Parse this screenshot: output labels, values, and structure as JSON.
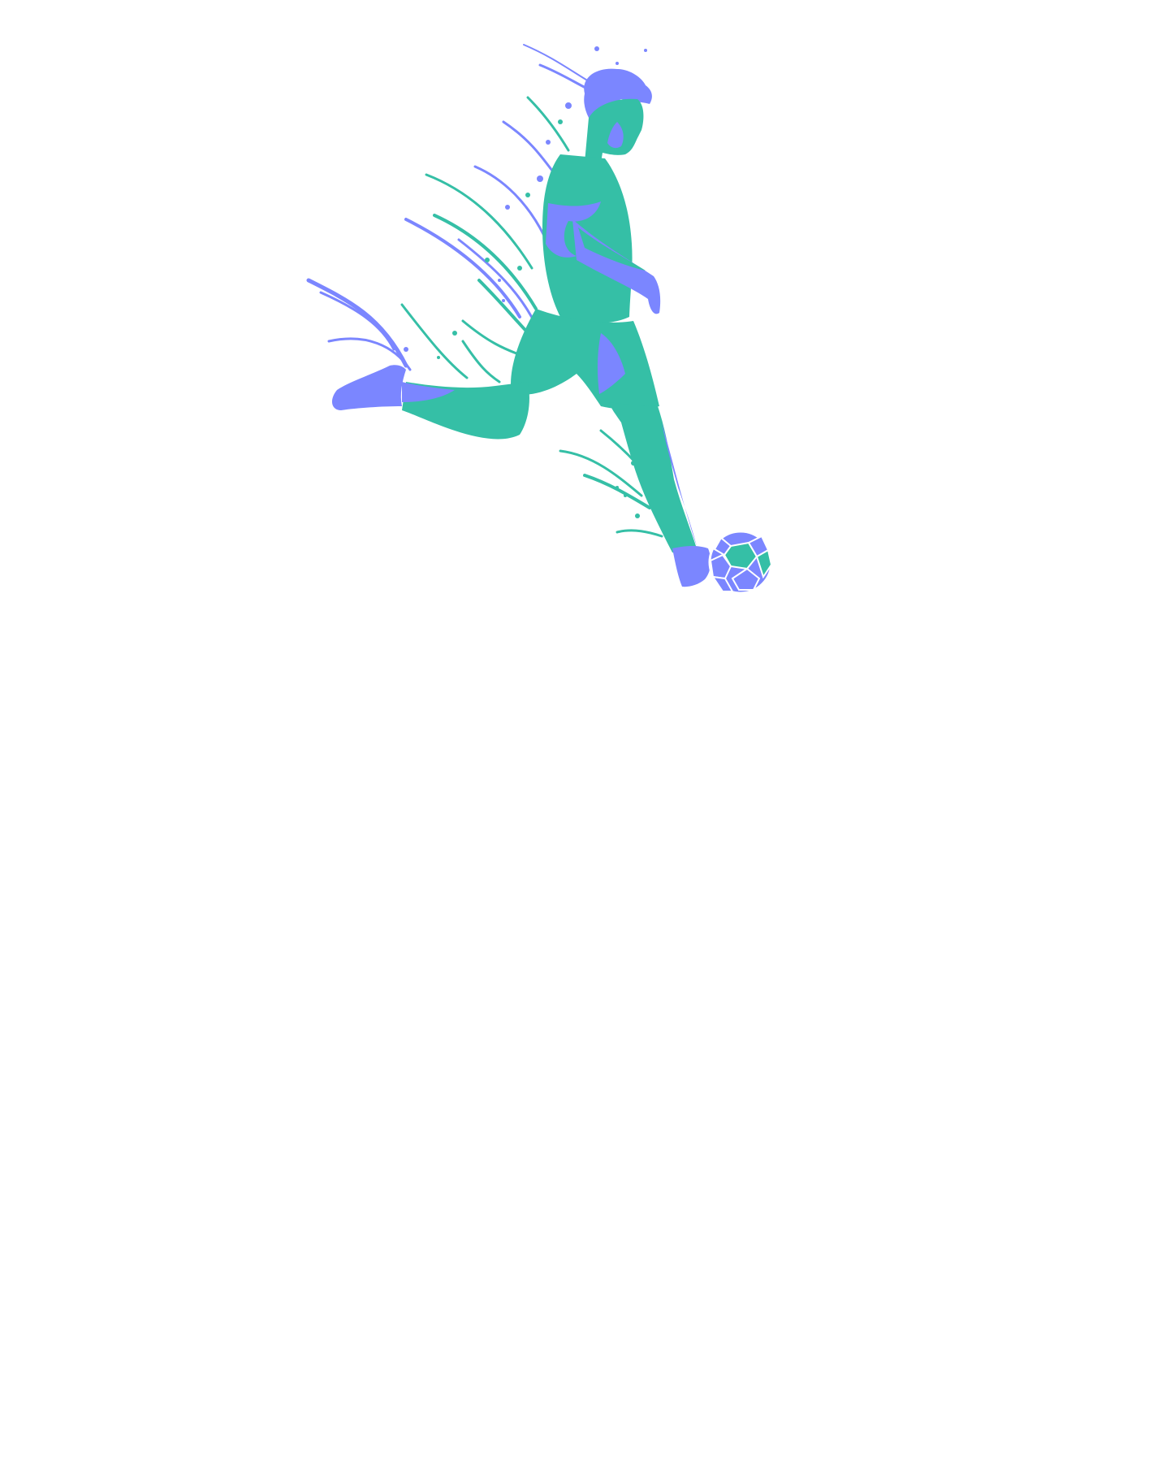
{
  "illustration": {
    "subject": "soccer-player-kicking-ball",
    "icon": "soccer-ball-icon",
    "colors": {
      "background": "#ffffff",
      "teal": "#35bfa6",
      "periwinkle": "#7b86ff",
      "ball_lines": "#ffffff"
    }
  }
}
